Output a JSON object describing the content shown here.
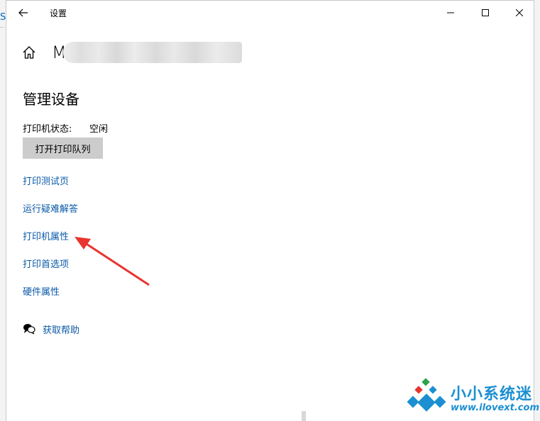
{
  "window": {
    "title": "设置",
    "controls": {
      "minimize_icon": "minimize-icon",
      "maximize_icon": "maximize-icon",
      "close_icon": "close-icon"
    }
  },
  "header": {
    "device_name_visible": "M",
    "home_icon": "home-icon"
  },
  "main": {
    "section_title": "管理设备",
    "printer_status_label": "打印机状态:",
    "printer_status_value": "空闲",
    "open_queue_button": "打开打印队列",
    "links": [
      {
        "label": "打印测试页"
      },
      {
        "label": "运行疑难解答"
      },
      {
        "label": "打印机属性"
      },
      {
        "label": "打印首选项"
      },
      {
        "label": "硬件属性"
      }
    ],
    "help": {
      "label": "获取帮助",
      "icon": "help-chat-icon"
    }
  },
  "annotation": {
    "arrow_color": "#e8352f"
  },
  "watermark": {
    "title": "小小系统迷",
    "url": "www.ilovext.com",
    "color": "#1b8fd2"
  },
  "colors": {
    "link": "#0b5aa8",
    "button_bg": "#cccccc"
  }
}
